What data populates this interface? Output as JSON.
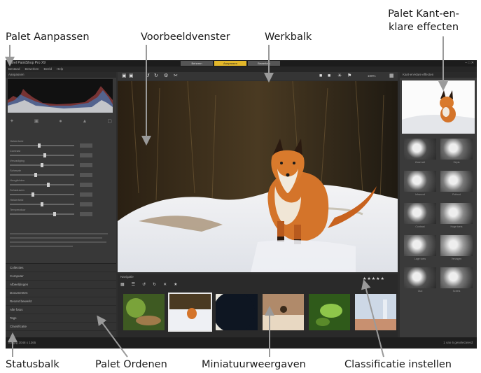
{
  "callouts": {
    "adjust_palette": "Palet Aanpassen",
    "preview_window": "Voorbeeldvenster",
    "toolbar": "Werkbalk",
    "presets_palette_line1": "Palet Kant-en-",
    "presets_palette_line2": "klare effecten",
    "statusbar": "Statusbalk",
    "organize_palette": "Palet Ordenen",
    "thumbnails": "Miniatuurweergaven",
    "set_rating": "Classificatie instellen"
  },
  "app": {
    "title": "Corel PaintShop Pro X9",
    "mode_tabs": [
      "Beheren",
      "Aanpassen",
      "Bewerken"
    ],
    "active_mode": 1,
    "window_controls": "– □ ✕",
    "menu": [
      "Bestand",
      "Bewerken",
      "Beeld",
      "Help"
    ]
  },
  "adjust_panel": {
    "header": "Aanpassen",
    "tools": [
      "✦",
      "▣",
      "●",
      "▲",
      "▢"
    ],
    "sliders": [
      {
        "label": "Helderheid",
        "level": 0.45
      },
      {
        "label": "Contrast",
        "level": 0.55
      },
      {
        "label": "Verzadiging",
        "level": 0.5
      },
      {
        "label": "Scherpte",
        "level": 0.4
      },
      {
        "label": "Hooglichten",
        "level": 0.6
      },
      {
        "label": "Schaduwen",
        "level": 0.35
      },
      {
        "label": "Helderheid",
        "level": 0.5
      },
      {
        "label": "Temperatuur",
        "level": 0.7
      }
    ]
  },
  "organize_panel": {
    "items": [
      "Collecties",
      "Computer",
      "Afbeeldingen",
      "Documenten",
      "Recent bewerkt",
      "Alle fotos",
      "Tags",
      "Classificatie"
    ]
  },
  "statusbar": {
    "left": "fox.jpg  2048 x 1365",
    "right": "1 van 6 geselecteerd"
  },
  "toolbar": {
    "icons": [
      "▣",
      "▣",
      "↺",
      "↻",
      "⚙",
      "✂",
      "■",
      "■",
      "☀",
      "⚑",
      "▦"
    ],
    "zoom": "100%"
  },
  "browser": {
    "header": "Navigatie",
    "tools": [
      "▦",
      "☰",
      "↺",
      "↻",
      "✕",
      "★"
    ],
    "rating": "★★★★★",
    "selected_index": 1
  },
  "presets": {
    "header": "Kant-en-klare effecten",
    "items": [
      "Zwart-wit",
      "Sepia",
      "Infrarood",
      "Potlood",
      "Contrast",
      "Hoge toets",
      "Lage toets",
      "Vervagen",
      "Oud",
      "Schets"
    ]
  },
  "colors": {
    "accent": "#e3b72a",
    "app_bg": "#2e2e2e"
  }
}
